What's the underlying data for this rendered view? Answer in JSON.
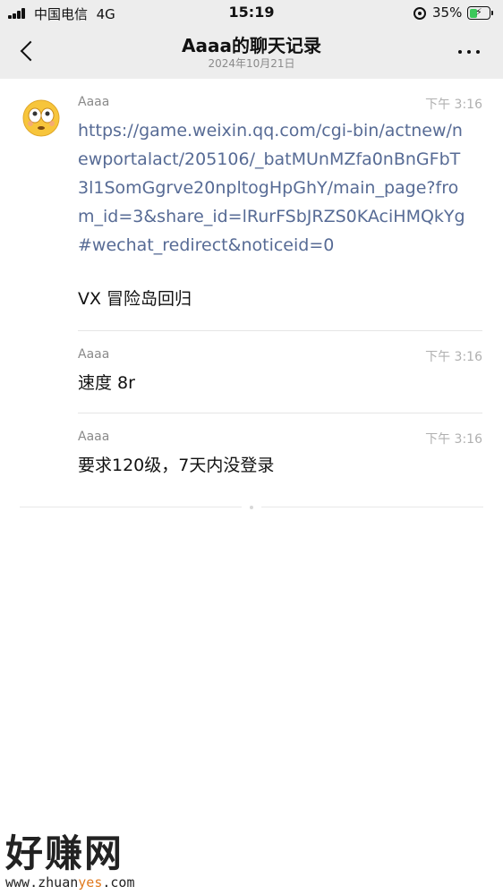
{
  "status_bar": {
    "carrier": "中国电信",
    "network": "4G",
    "time": "15:19",
    "battery": "35%",
    "battery_level": 0.35
  },
  "nav": {
    "title": "Aaaa的聊天记录",
    "subtitle": "2024年10月21日"
  },
  "messages": [
    {
      "sender": "Aaaa",
      "time": "下午 3:16",
      "link": "https://game.weixin.qq.com/cgi-bin/actnew/newportalact/205106/_batMUnMZfa0nBnGFbT3l1SomGgrve20npltogHpGhY/main_page?from_id=3&share_id=lRurFSbJRZS0KAciHMQkYg#wechat_redirect&noticeid=0",
      "text": "VX 冒险岛回归"
    },
    {
      "sender": "Aaaa",
      "time": "下午 3:16",
      "text": "速度 8r"
    },
    {
      "sender": "Aaaa",
      "time": "下午 3:16",
      "text": "要求120级，7天内没登录"
    }
  ],
  "watermark": {
    "brand": "好赚网",
    "url_prefix": "www.zhuan",
    "url_highlight": "yes",
    "url_suffix": ".com"
  }
}
